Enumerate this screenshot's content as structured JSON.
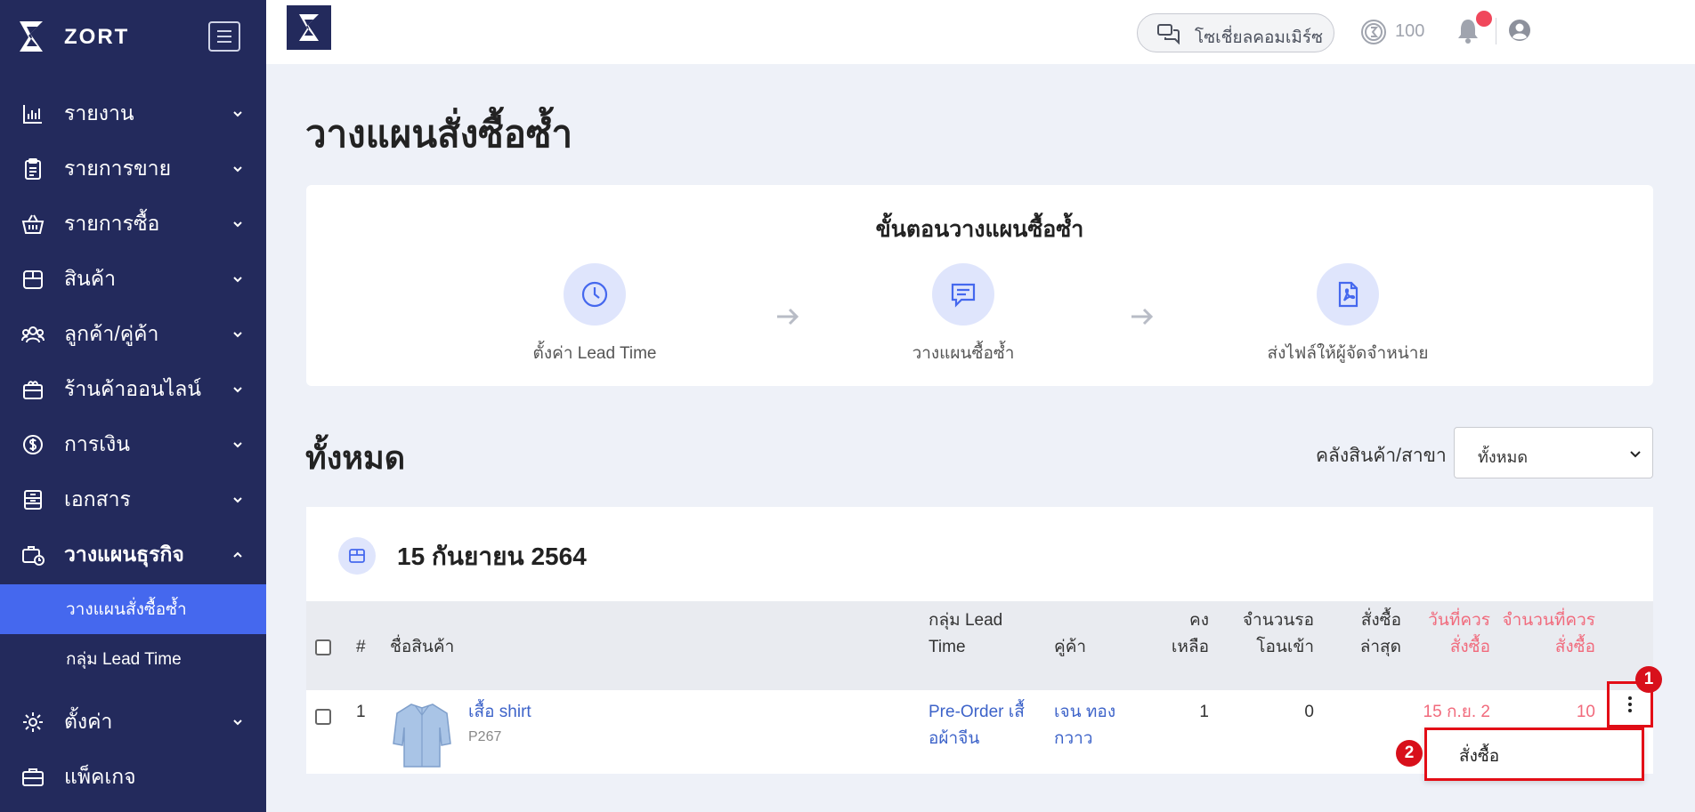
{
  "sidebar": {
    "brand": "ZORT",
    "items": [
      {
        "label": "รายงาน",
        "icon": "bar-chart-icon"
      },
      {
        "label": "รายการขาย",
        "icon": "clipboard-icon"
      },
      {
        "label": "รายการซื้อ",
        "icon": "basket-icon"
      },
      {
        "label": "สินค้า",
        "icon": "box-icon"
      },
      {
        "label": "ลูกค้า/คู่ค้า",
        "icon": "users-icon"
      },
      {
        "label": "ร้านค้าออนไลน์",
        "icon": "store-icon"
      },
      {
        "label": "การเงิน",
        "icon": "dollar-icon"
      },
      {
        "label": "เอกสาร",
        "icon": "document-icon"
      },
      {
        "label": "วางแผนธุรกิจ",
        "icon": "business-plan-icon"
      }
    ],
    "subitems": [
      {
        "label": "วางแผนสั่งซื้อซ้ำ"
      },
      {
        "label": "กลุ่ม Lead Time"
      }
    ],
    "bottom_items": [
      {
        "label": "ตั้งค่า",
        "icon": "gear-icon"
      },
      {
        "label": "แพ็คเกจ",
        "icon": "briefcase-icon"
      }
    ]
  },
  "topbar": {
    "social_label": "โซเชี่ยลคอมเมิร์ซ",
    "credits": "100"
  },
  "page": {
    "title": "วางแผนสั่งซื้อซ้ำ",
    "steps_title": "ขั้นตอนวางแผนซื้อซ้ำ",
    "steps": [
      {
        "label": "ตั้งค่า Lead Time",
        "icon": "clock-icon"
      },
      {
        "label": "วางแผนซื้อซ้ำ",
        "icon": "message-icon"
      },
      {
        "label": "ส่งไฟล์ให้ผู้จัดจำหน่าย",
        "icon": "pdf-file-icon"
      }
    ],
    "section_title": "ทั้งหมด",
    "filter_label": "คลังสินค้า/สาขา",
    "filter_value": "ทั้งหมด"
  },
  "table": {
    "group_date": "15 กันยายน 2564",
    "headers": {
      "index": "#",
      "name": "ชื่อสินค้า",
      "lead_group_1": "กลุ่ม Lead",
      "lead_group_2": "Time",
      "vendor": "คู่ค้า",
      "remain_1": "คง",
      "remain_2": "เหลือ",
      "incoming_1": "จำนวนรอ",
      "incoming_2": "โอนเข้า",
      "last_1": "สั่งซื้อ",
      "last_2": "ล่าสุด",
      "order_date_1": "วันที่ควร",
      "order_date_2": "สั่งซื้อ",
      "order_qty_1": "จำนวนที่ควร",
      "order_qty_2": "สั่งซื้อ"
    },
    "rows": [
      {
        "index": "1",
        "name": "เสื้อ shirt",
        "sku": "P267",
        "lead_group_1": "Pre-Order เสื้",
        "lead_group_2": "อผ้าจีน",
        "vendor_1": "เจน ทอง",
        "vendor_2": "กวาว",
        "remain": "1",
        "incoming": "0",
        "order_date": "15 ก.ย. 2",
        "order_qty": "10"
      }
    ]
  },
  "annotations": {
    "badge_1": "1",
    "badge_2": "2"
  },
  "dropdown": {
    "item": "สั่งซื้อ"
  },
  "colors": {
    "sidebar_bg": "#232a5c",
    "active_bg": "#4568ee",
    "accent_red": "#f16a7c",
    "highlight_red": "#e30d16",
    "link": "#3d63c9"
  }
}
